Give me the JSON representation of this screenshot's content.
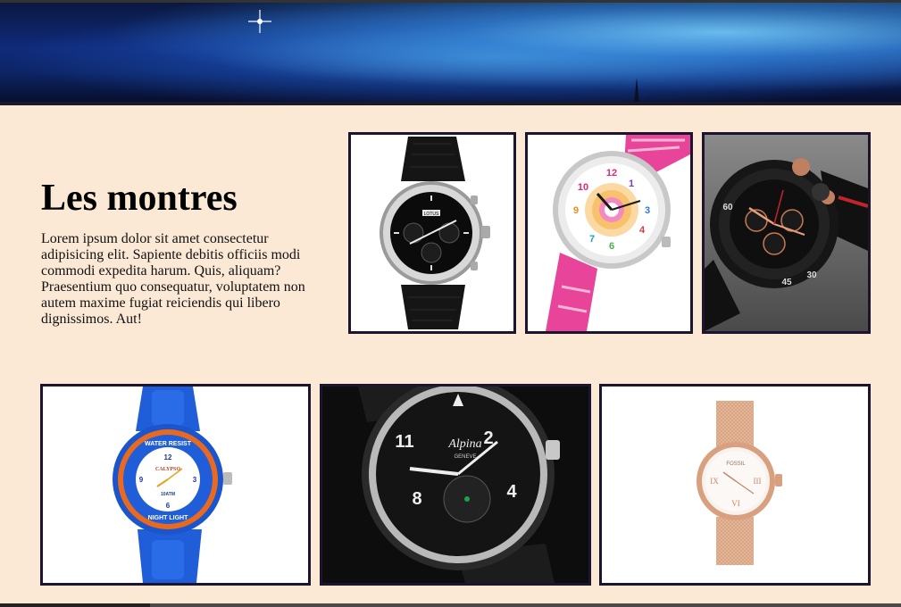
{
  "section": {
    "heading": "Les montres",
    "intro": "Lorem ipsum dolor sit amet consectetur adipisicing elit. Sapiente debitis officiis modi commodi expedita harum. Quis, aliquam? Praesentium quo consequatur, voluptatem non autem maxime fugiat reiciendis qui libero dignissimos. Aut!"
  },
  "watches": [
    {
      "id": "black-leather-chronograph",
      "brand_mark": "LOTUS"
    },
    {
      "id": "pink-kids-watch",
      "brand_mark": ""
    },
    {
      "id": "black-sport-chronograph",
      "brand_mark": ""
    },
    {
      "id": "blue-kids-watch",
      "brand_mark": "CALYPSO",
      "ring_top": "WATER RESIST",
      "ring_bottom": "NIGHT LIGHT",
      "dial_small": "10ATM"
    },
    {
      "id": "pilot-watch",
      "brand_mark": "Alpina",
      "brand_sub": "GENEVE"
    },
    {
      "id": "rose-gold-mesh-watch",
      "brand_mark": "FOSSIL"
    }
  ],
  "colors": {
    "page_background": "#fbe9d5",
    "photo_border": "#1b1530",
    "banner_deep": "#0d2566",
    "banner_glow": "#78d2ff"
  }
}
